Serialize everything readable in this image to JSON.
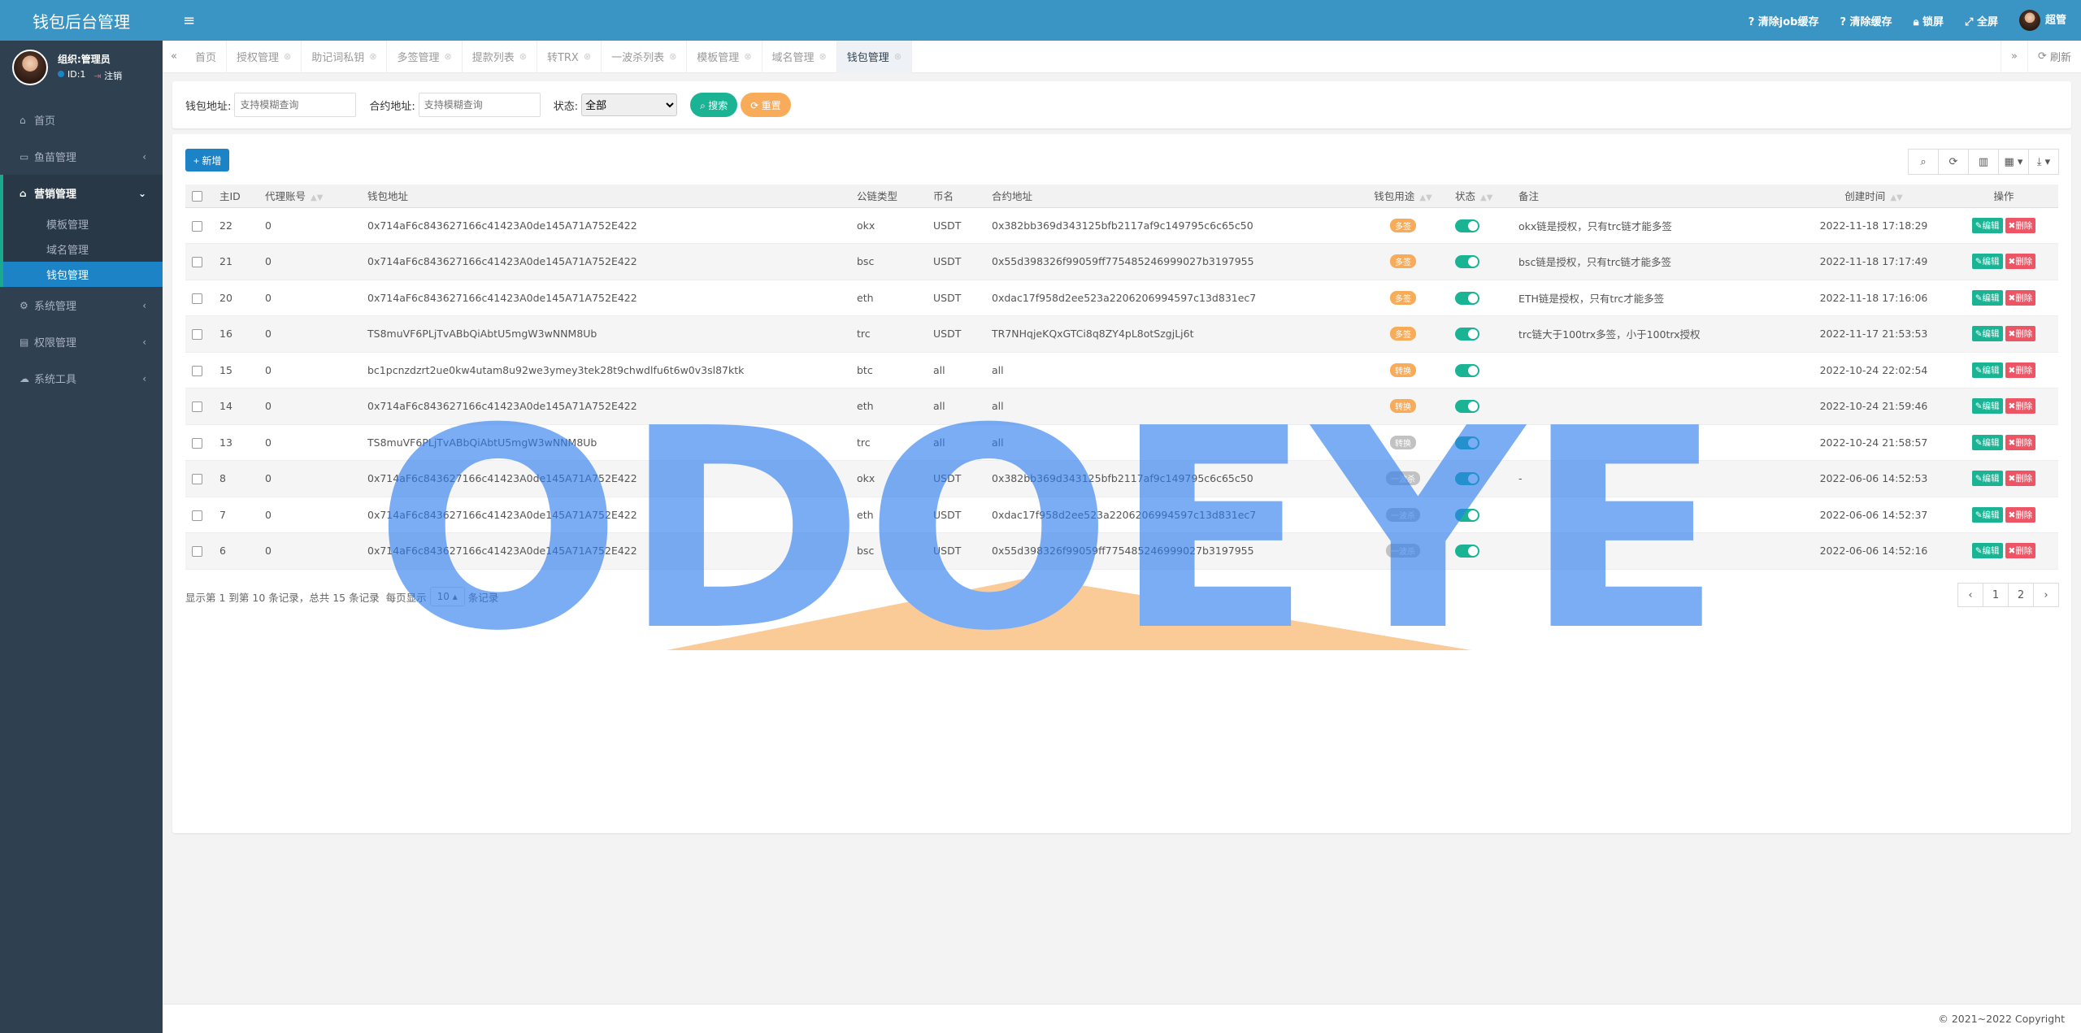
{
  "app": {
    "title": "钱包后台管理"
  },
  "user": {
    "name": "组织:管理员",
    "id_label": "ID:1",
    "logout_label": "注销",
    "top_name": "超管"
  },
  "sidebar": {
    "items": [
      {
        "label": "首页",
        "icon": "home-icon"
      },
      {
        "label": "鱼苗管理",
        "icon": "money-icon"
      },
      {
        "label": "营销管理",
        "icon": "bank-icon"
      },
      {
        "label": "系统管理",
        "icon": "gear-icon"
      },
      {
        "label": "权限管理",
        "icon": "id-card-icon"
      },
      {
        "label": "系统工具",
        "icon": "cloud-icon"
      }
    ],
    "sub_items": [
      {
        "label": "模板管理"
      },
      {
        "label": "域名管理"
      },
      {
        "label": "钱包管理"
      }
    ]
  },
  "topbar": {
    "clear_job": "清除job缓存",
    "clear_data": "清除缓存",
    "lock": "锁屏",
    "fullscreen": "全屏"
  },
  "tabs": [
    {
      "label": "首页",
      "closable": false
    },
    {
      "label": "授权管理",
      "closable": true
    },
    {
      "label": "助记词私钥",
      "closable": true
    },
    {
      "label": "多签管理",
      "closable": true
    },
    {
      "label": "提款列表",
      "closable": true
    },
    {
      "label": "转TRX",
      "closable": true
    },
    {
      "label": "一波杀列表",
      "closable": true
    },
    {
      "label": "模板管理",
      "closable": true
    },
    {
      "label": "域名管理",
      "closable": true
    },
    {
      "label": "钱包管理",
      "closable": true,
      "active": true
    }
  ],
  "tabbar": {
    "refresh": "刷新"
  },
  "search": {
    "wallet_label": "钱包地址:",
    "wallet_placeholder": "支持模糊查询",
    "contract_label": "合约地址:",
    "contract_placeholder": "支持模糊查询",
    "status_label": "状态:",
    "status_value": "全部",
    "search_btn": "搜索",
    "reset_btn": "重置"
  },
  "toolbar": {
    "add": "新增"
  },
  "table": {
    "headers": [
      "主ID",
      "代理账号",
      "钱包地址",
      "公链类型",
      "币名",
      "合约地址",
      "钱包用途",
      "状态",
      "备注",
      "创建时间",
      "操作"
    ],
    "edit_label": "编辑",
    "delete_label": "删除",
    "rows": [
      {
        "id": "22",
        "agent": "0",
        "wallet": "0x714aF6c843627166c41423A0de145A71A752E422",
        "chain": "okx",
        "coin": "USDT",
        "contract": "0x382bb369d343125bfb2117af9c149795c6c65c50",
        "purpose": "多签",
        "purpose_style": "orange",
        "remark": "okx链是授权，只有trc链才能多签",
        "time": "2022-11-18 17:18:29"
      },
      {
        "id": "21",
        "agent": "0",
        "wallet": "0x714aF6c843627166c41423A0de145A71A752E422",
        "chain": "bsc",
        "coin": "USDT",
        "contract": "0x55d398326f99059ff775485246999027b3197955",
        "purpose": "多签",
        "purpose_style": "orange",
        "remark": "bsc链是授权，只有trc链才能多签",
        "time": "2022-11-18 17:17:49"
      },
      {
        "id": "20",
        "agent": "0",
        "wallet": "0x714aF6c843627166c41423A0de145A71A752E422",
        "chain": "eth",
        "coin": "USDT",
        "contract": "0xdac17f958d2ee523a2206206994597c13d831ec7",
        "purpose": "多签",
        "purpose_style": "orange",
        "remark": "ETH链是授权，只有trc才能多签",
        "time": "2022-11-18 17:16:06"
      },
      {
        "id": "16",
        "agent": "0",
        "wallet": "TS8muVF6PLjTvABbQiAbtU5mgW3wNNM8Ub",
        "chain": "trc",
        "coin": "USDT",
        "contract": "TR7NHqjeKQxGTCi8q8ZY4pL8otSzgjLj6t",
        "purpose": "多签",
        "purpose_style": "orange",
        "remark": "trc链大于100trx多签，小于100trx授权",
        "time": "2022-11-17 21:53:53"
      },
      {
        "id": "15",
        "agent": "0",
        "wallet": "bc1pcnzdzrt2ue0kw4utam8u92we3ymey3tek28t9chwdlfu6t6w0v3sl87ktk",
        "chain": "btc",
        "coin": "all",
        "contract": "all",
        "purpose": "转换",
        "purpose_style": "orange",
        "remark": "",
        "time": "2022-10-24 22:02:54"
      },
      {
        "id": "14",
        "agent": "0",
        "wallet": "0x714aF6c843627166c41423A0de145A71A752E422",
        "chain": "eth",
        "coin": "all",
        "contract": "all",
        "purpose": "转换",
        "purpose_style": "orange",
        "remark": "",
        "time": "2022-10-24 21:59:46"
      },
      {
        "id": "13",
        "agent": "0",
        "wallet": "TS8muVF6PLjTvABbQiAbtU5mgW3wNNM8Ub",
        "chain": "trc",
        "coin": "all",
        "contract": "all",
        "purpose": "转换",
        "purpose_style": "gray",
        "remark": "",
        "time": "2022-10-24 21:58:57"
      },
      {
        "id": "8",
        "agent": "0",
        "wallet": "0x714aF6c843627166c41423A0de145A71A752E422",
        "chain": "okx",
        "coin": "USDT",
        "contract": "0x382bb369d343125bfb2117af9c149795c6c65c50",
        "purpose": "一波杀",
        "purpose_style": "gray",
        "remark": "-",
        "time": "2022-06-06 14:52:53"
      },
      {
        "id": "7",
        "agent": "0",
        "wallet": "0x714aF6c843627166c41423A0de145A71A752E422",
        "chain": "eth",
        "coin": "USDT",
        "contract": "0xdac17f958d2ee523a2206206994597c13d831ec7",
        "purpose": "一波杀",
        "purpose_style": "gray",
        "remark": "",
        "time": "2022-06-06 14:52:37"
      },
      {
        "id": "6",
        "agent": "0",
        "wallet": "0x714aF6c843627166c41423A0de145A71A752E422",
        "chain": "bsc",
        "coin": "USDT",
        "contract": "0x55d398326f99059ff775485246999027b3197955",
        "purpose": "一波杀",
        "purpose_style": "gray",
        "remark": "",
        "time": "2022-06-06 14:52:16"
      }
    ]
  },
  "pagination": {
    "info_prefix": "显示第 1 到第 10 条记录，总共 15 条记录",
    "per_page_label": "每页显示",
    "page_size": "10",
    "per_page_suffix": "条记录",
    "prev": "‹",
    "pages": [
      "1",
      "2"
    ],
    "next": "›"
  },
  "footer": {
    "copyright": "© 2021~2022 Copyright"
  },
  "watermark": {
    "text": "ODOEYE"
  },
  "colors": {
    "brand": "#3a95c5",
    "sidebar": "#2f4050",
    "green": "#1ab394",
    "orange": "#f8ac59",
    "red": "#ed5565",
    "blue": "#1c84c6"
  }
}
